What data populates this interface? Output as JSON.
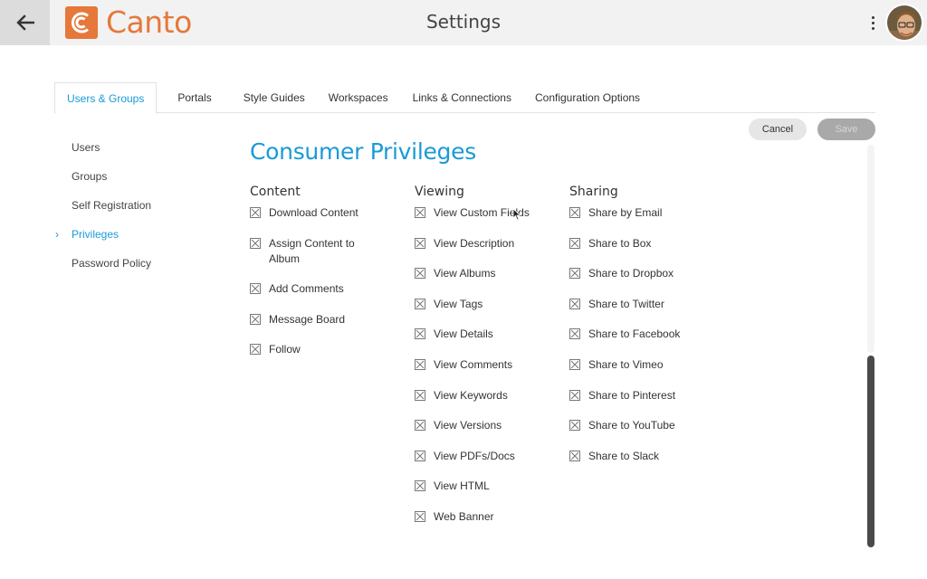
{
  "header": {
    "logo_text": "Canto",
    "title": "Settings",
    "back_icon": "arrow-left-icon",
    "menu_icon": "more-vertical-icon",
    "brand_color": "#e5783a"
  },
  "tabs": [
    {
      "label": "Users & Groups",
      "active": true
    },
    {
      "label": "Portals"
    },
    {
      "label": "Style Guides"
    },
    {
      "label": "Workspaces"
    },
    {
      "label": "Links & Connections"
    },
    {
      "label": "Configuration Options"
    }
  ],
  "actions": {
    "cancel": "Cancel",
    "save": "Save"
  },
  "sidenav": [
    {
      "label": "Users"
    },
    {
      "label": "Groups"
    },
    {
      "label": "Self Registration"
    },
    {
      "label": "Privileges",
      "active": true
    },
    {
      "label": "Password Policy"
    }
  ],
  "main": {
    "heading": "Consumer Privileges",
    "accent_color": "#1a9ad6",
    "columns": [
      {
        "title": "Content",
        "options": [
          "Download Content",
          "Assign Content to Album",
          "Add Comments",
          "Message Board",
          "Follow"
        ]
      },
      {
        "title": "Viewing",
        "options": [
          "View Custom Fields",
          "View Description",
          "View Albums",
          "View Tags",
          "View Details",
          "View Comments",
          "View Keywords",
          "View Versions",
          "View PDFs/Docs",
          "View HTML",
          "Web Banner"
        ]
      },
      {
        "title": "Sharing",
        "options": [
          "Share by Email",
          "Share to Box",
          "Share to Dropbox",
          "Share to Twitter",
          "Share to Facebook",
          "Share to Vimeo",
          "Share to Pinterest",
          "Share to YouTube",
          "Share to Slack"
        ]
      }
    ]
  }
}
